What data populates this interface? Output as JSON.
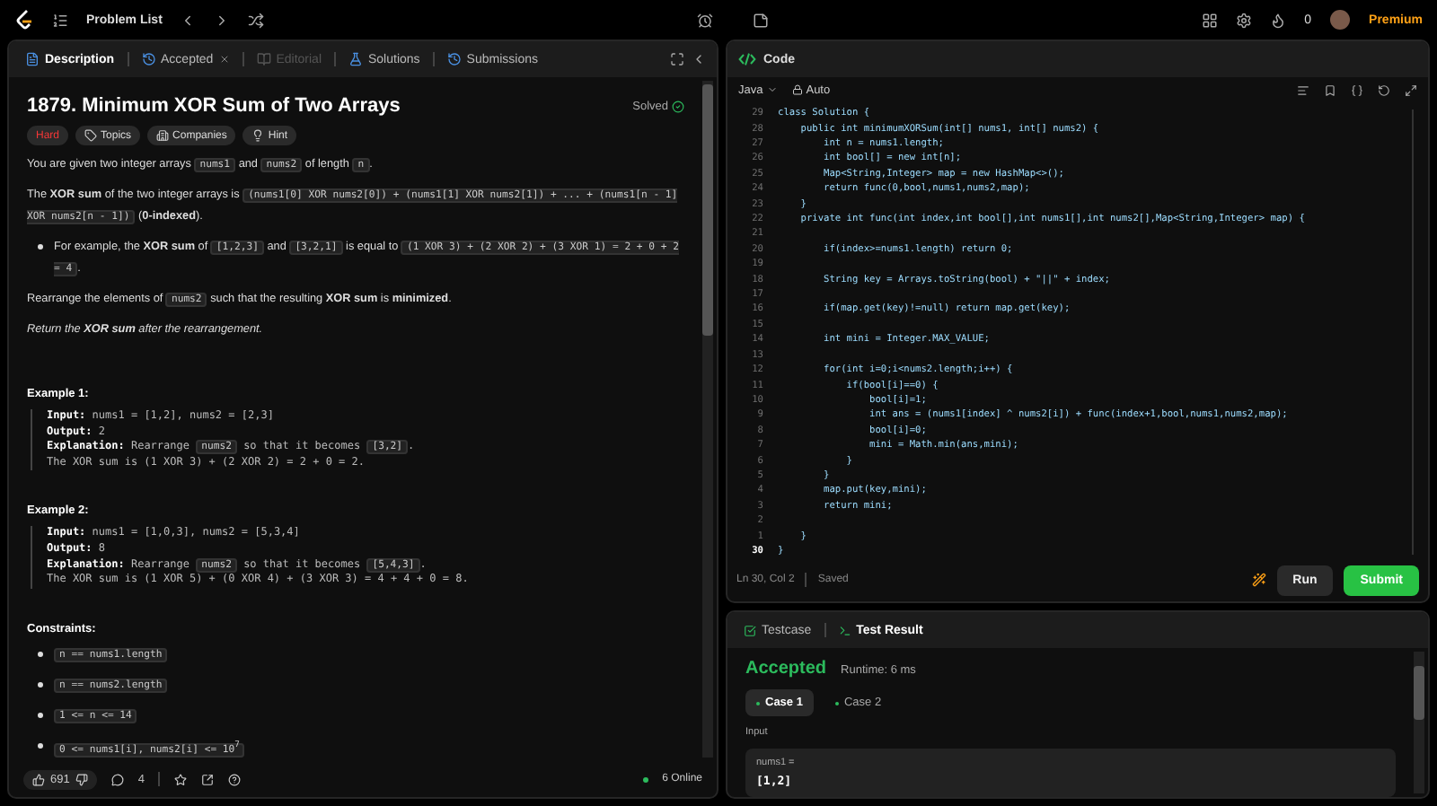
{
  "topbar": {
    "title": "Problem List",
    "streak": "0",
    "premium": "Premium"
  },
  "description": {
    "tabs": [
      {
        "label": "Description",
        "kind": "description",
        "selected": true,
        "disabled": false,
        "closable": false
      },
      {
        "label": "Accepted",
        "kind": "accepted",
        "selected": false,
        "disabled": false,
        "closable": true
      },
      {
        "label": "Editorial",
        "kind": "editorial",
        "selected": false,
        "disabled": true,
        "closable": false
      },
      {
        "label": "Solutions",
        "kind": "solutions",
        "selected": false,
        "disabled": false,
        "closable": false
      },
      {
        "label": "Submissions",
        "kind": "submissions",
        "selected": false,
        "disabled": false,
        "closable": false
      }
    ],
    "title": "1879. Minimum XOR Sum of Two Arrays",
    "status": "Solved",
    "tags": [
      {
        "label": "Hard",
        "kind": "difficulty"
      },
      {
        "label": "Topics",
        "kind": "topics"
      },
      {
        "label": "Companies",
        "kind": "companies"
      },
      {
        "label": "Hint",
        "kind": "hint"
      }
    ],
    "content": [
      {
        "kind": "paragraph",
        "segments": [
          {
            "kind": "text",
            "text": "You are given two integer arrays "
          },
          {
            "kind": "code",
            "text": "nums1"
          },
          {
            "kind": "text",
            "text": " and "
          },
          {
            "kind": "code",
            "text": "nums2"
          },
          {
            "kind": "text",
            "text": " of length "
          },
          {
            "kind": "code",
            "text": "n"
          },
          {
            "kind": "text",
            "text": "."
          }
        ]
      },
      {
        "kind": "paragraph",
        "segments": [
          {
            "kind": "text",
            "text": "The **XOR sum** of the two integer arrays is "
          },
          {
            "kind": "code",
            "text": "(nums1[0] XOR nums2[0]) + (nums1[1] XOR nums2[1]) + ... + (nums1[n - 1] XOR nums2[n - 1])"
          },
          {
            "kind": "text",
            "text": " (**0-indexed**)."
          }
        ]
      },
      {
        "kind": "bullet",
        "segments": [
          {
            "kind": "text",
            "text": "For example, the **XOR sum** of "
          },
          {
            "kind": "code",
            "text": "[1,2,3]"
          },
          {
            "kind": "text",
            "text": " and "
          },
          {
            "kind": "code",
            "text": "[3,2,1]"
          },
          {
            "kind": "text",
            "text": " is equal to "
          },
          {
            "kind": "code",
            "text": "(1 XOR 3) + (2 XOR 2) + (3 XOR 1) = 2 + 0 + 2 = 4"
          },
          {
            "kind": "text",
            "text": "."
          }
        ]
      },
      {
        "kind": "paragraph",
        "segments": [
          {
            "kind": "text",
            "text": "Rearrange the elements of "
          },
          {
            "kind": "code",
            "text": "nums2"
          },
          {
            "kind": "text",
            "text": " such that the resulting **XOR sum** is **minimized**."
          }
        ]
      },
      {
        "kind": "note",
        "text": "Return the **XOR sum** after the rearrangement."
      },
      {
        "kind": "heading",
        "text": "Example 1:"
      },
      {
        "kind": "example",
        "lines": [
          [
            {
              "kind": "text",
              "text": "**Input:** nums1 = [1,2], nums2 = [2,3]"
            }
          ],
          [
            {
              "kind": "text",
              "text": "**Output:** 2"
            }
          ],
          [
            {
              "kind": "text",
              "text": "**Explanation:** Rearrange "
            },
            {
              "kind": "code",
              "text": "nums2"
            },
            {
              "kind": "text",
              "text": " so that it becomes "
            },
            {
              "kind": "code",
              "text": "[3,2]"
            },
            {
              "kind": "text",
              "text": "."
            }
          ],
          [
            {
              "kind": "text",
              "text": "The XOR sum is (1 XOR 3) + (2 XOR 2) = 2 + 0 = 2."
            }
          ]
        ]
      },
      {
        "kind": "heading",
        "text": "Example 2:"
      },
      {
        "kind": "example",
        "lines": [
          [
            {
              "kind": "text",
              "text": "**Input:** nums1 = [1,0,3], nums2 = [5,3,4]"
            }
          ],
          [
            {
              "kind": "text",
              "text": "**Output:** 8"
            }
          ],
          [
            {
              "kind": "text",
              "text": "**Explanation:** Rearrange "
            },
            {
              "kind": "code",
              "text": "nums2"
            },
            {
              "kind": "text",
              "text": " so that it becomes "
            },
            {
              "kind": "code",
              "text": "[5,4,3]"
            },
            {
              "kind": "text",
              "text": "."
            }
          ],
          [
            {
              "kind": "text",
              "text": "The XOR sum is (1 XOR 5) + (0 XOR 4) + (3 XOR 3) = 4 + 4 + 0 = 8."
            }
          ]
        ]
      },
      {
        "kind": "heading",
        "text": "Constraints:"
      },
      {
        "kind": "bullet",
        "segments": [
          {
            "kind": "code",
            "text": "n == nums1.length"
          }
        ]
      },
      {
        "kind": "bullet",
        "segments": [
          {
            "kind": "code",
            "text": "n == nums2.length"
          }
        ]
      },
      {
        "kind": "bullet",
        "segments": [
          {
            "kind": "code",
            "text": "1 <= n <= 14"
          }
        ]
      },
      {
        "kind": "bullet",
        "segments": [
          {
            "kind": "code",
            "text": "0 <= nums1[i], nums2[i] <= 10$^{7}$"
          }
        ]
      }
    ],
    "footer": {
      "likes": "691",
      "comments": "4",
      "online": "6 Online"
    }
  },
  "editor": {
    "title": "Code",
    "language": "Java",
    "mode": "Auto",
    "lines": [
      {
        "number": "29",
        "text": "class Solution {",
        "current": false
      },
      {
        "number": "28",
        "text": "    public int minimumXORSum(int[] nums1, int[] nums2) {",
        "current": false
      },
      {
        "number": "27",
        "text": "        int n = nums1.length;",
        "current": false
      },
      {
        "number": "26",
        "text": "        int bool[] = new int[n];",
        "current": false
      },
      {
        "number": "25",
        "text": "        Map<String,Integer> map = new HashMap<>();",
        "current": false
      },
      {
        "number": "24",
        "text": "        return func(0,bool,nums1,nums2,map);",
        "current": false
      },
      {
        "number": "23",
        "text": "    }",
        "current": false
      },
      {
        "number": "22",
        "text": "    private int func(int index,int bool[],int nums1[],int nums2[],Map<String,Integer> map) {",
        "current": false
      },
      {
        "number": "21",
        "current": false
      },
      {
        "number": "20",
        "text": "        if(index>=nums1.length) return 0;",
        "current": false
      },
      {
        "number": "19",
        "current": false
      },
      {
        "number": "18",
        "text": "        String key = Arrays.toString(bool) + \"||\" + index;",
        "current": false
      },
      {
        "number": "17",
        "current": false
      },
      {
        "number": "16",
        "text": "        if(map.get(key)!=null) return map.get(key);",
        "current": false
      },
      {
        "number": "15",
        "current": false
      },
      {
        "number": "14",
        "text": "        int mini = Integer.MAX_VALUE;",
        "current": false
      },
      {
        "number": "13",
        "current": false
      },
      {
        "number": "12",
        "text": "        for(int i=0;i<nums2.length;i++) {",
        "current": false
      },
      {
        "number": "11",
        "text": "            if(bool[i]==0) {",
        "current": false
      },
      {
        "number": "10",
        "text": "                bool[i]=1;",
        "current": false
      },
      {
        "number": "9",
        "text": "                int ans = (nums1[index] ^ nums2[i]) + func(index+1,bool,nums1,nums2,map);",
        "current": false
      },
      {
        "number": "8",
        "text": "                bool[i]=0;",
        "current": false
      },
      {
        "number": "7",
        "text": "                mini = Math.min(ans,mini);",
        "current": false
      },
      {
        "number": "6",
        "text": "            }",
        "current": false
      },
      {
        "number": "5",
        "text": "        }",
        "current": false
      },
      {
        "number": "4",
        "text": "        map.put(key,mini);",
        "current": false
      },
      {
        "number": "3",
        "text": "        return mini;",
        "current": false
      },
      {
        "number": "2",
        "current": false
      },
      {
        "number": "1",
        "text": "    }",
        "current": false
      },
      {
        "number": "30",
        "text": "}",
        "current": true
      }
    ],
    "cursor": "Ln 30, Col 2",
    "saved": "Saved",
    "run": "Run",
    "submit": "Submit"
  },
  "results": {
    "tabs": [
      {
        "label": "Testcase",
        "kind": "testcase",
        "selected": false
      },
      {
        "label": "Test Result",
        "kind": "result",
        "selected": true
      }
    ],
    "verdict": "Accepted",
    "runtime": "Runtime: 6 ms",
    "cases": [
      {
        "label": "Case 1",
        "selected": true
      },
      {
        "label": "Case 2",
        "selected": false
      }
    ],
    "input_label": "Input",
    "inputs": [
      {
        "name": "nums1 =",
        "value": "[1,2]"
      }
    ]
  }
}
